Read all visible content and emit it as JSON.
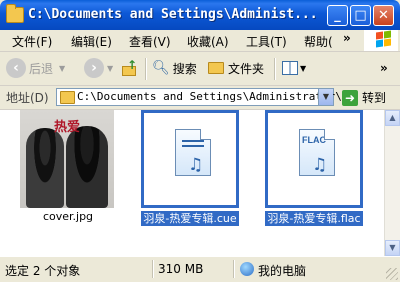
{
  "window": {
    "title": "C:\\Documents and Settings\\Administ..."
  },
  "title_buttons": {
    "minimize": "_",
    "maximize": "□",
    "close": "✕"
  },
  "menu": [
    "文件(F)",
    "编辑(E)",
    "查看(V)",
    "收藏(A)",
    "工具(T)",
    "帮助(",
    "»"
  ],
  "toolbar": {
    "back_label": "后退",
    "search_label": "搜索",
    "folders_label": "文件夹",
    "overflow": "»"
  },
  "address": {
    "label": "地址(D)",
    "value": "C:\\Documents and Settings\\Administrator\\",
    "go_label": "转到"
  },
  "files": [
    {
      "name": "cover.jpg",
      "type": "image",
      "selected": false,
      "cover_text": "热爱"
    },
    {
      "name": "羽泉-热爱专辑.cue",
      "type": "cue",
      "selected": true
    },
    {
      "name": "羽泉-热爱专辑.flac",
      "type": "flac",
      "selected": true,
      "icon_text": "FLAC"
    }
  ],
  "status": {
    "selection": "选定 2 个对象",
    "size": "310 MB",
    "location": "我的电脑"
  }
}
